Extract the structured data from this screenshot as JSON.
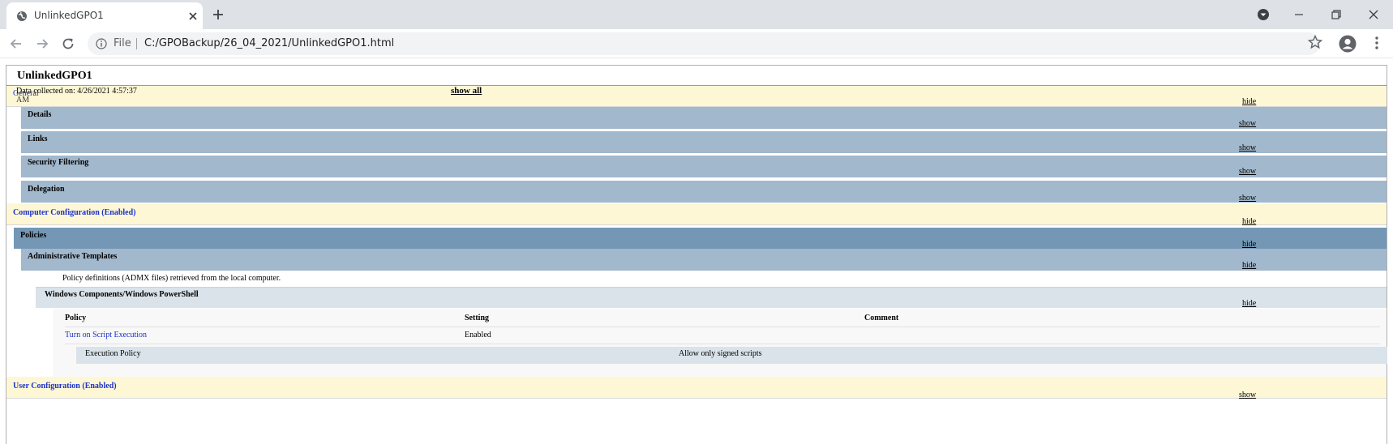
{
  "browser": {
    "tab_title": "UnlinkedGPO1",
    "omnibox": {
      "scheme_label": "File",
      "url": "C:/GPOBackup/26_04_2021/UnlinkedGPO1.html"
    }
  },
  "report": {
    "title": "UnlinkedGPO1",
    "collected_on": "Data collected on: 4/26/2021 4:57:37",
    "collected_on_ampm": "AM",
    "show_all": "show all",
    "general": {
      "label": "General",
      "toggle": "hide",
      "subsections": [
        {
          "label": "Details",
          "toggle": "show"
        },
        {
          "label": "Links",
          "toggle": "show"
        },
        {
          "label": "Security Filtering",
          "toggle": "show"
        },
        {
          "label": "Delegation",
          "toggle": "show"
        }
      ]
    },
    "computer_configuration": {
      "label": "Computer Configuration (Enabled)",
      "toggle": "hide",
      "policies": {
        "label": "Policies",
        "toggle": "hide"
      },
      "admin_templates": {
        "label": "Administrative Templates",
        "toggle": "hide",
        "note": "Policy definitions (ADMX files) retrieved from the local computer."
      },
      "category": {
        "label": "Windows Components/Windows PowerShell",
        "toggle": "hide"
      },
      "table": {
        "headers": [
          "Policy",
          "Setting",
          "Comment"
        ],
        "rows": [
          {
            "policy": "Turn on Script Execution",
            "setting": "Enabled",
            "comment": ""
          }
        ],
        "sub_row": {
          "label": "Execution Policy",
          "value": "Allow only signed scripts"
        }
      }
    },
    "user_configuration": {
      "label": "User Configuration (Enabled)",
      "toggle": "show"
    }
  },
  "colors": {
    "cream_header": "#fef7d6",
    "blue_header": "#a2b8cc",
    "dark_blue_header": "#7397b5",
    "light_header": "#dae3ea",
    "link": "#1a32c9"
  },
  "icons": {
    "tab_favicon": "globe-icon",
    "tab_close": "close-icon",
    "new_tab": "plus-icon",
    "tab_search": "chevron-down-icon",
    "minimize": "minimize-icon",
    "restore": "restore-icon",
    "close_window": "close-icon",
    "back": "arrow-left-icon",
    "forward": "arrow-right-icon",
    "reload": "reload-icon",
    "site_info": "info-icon",
    "bookmark": "star-icon",
    "profile": "avatar-icon",
    "menu": "kebab-menu-icon"
  }
}
